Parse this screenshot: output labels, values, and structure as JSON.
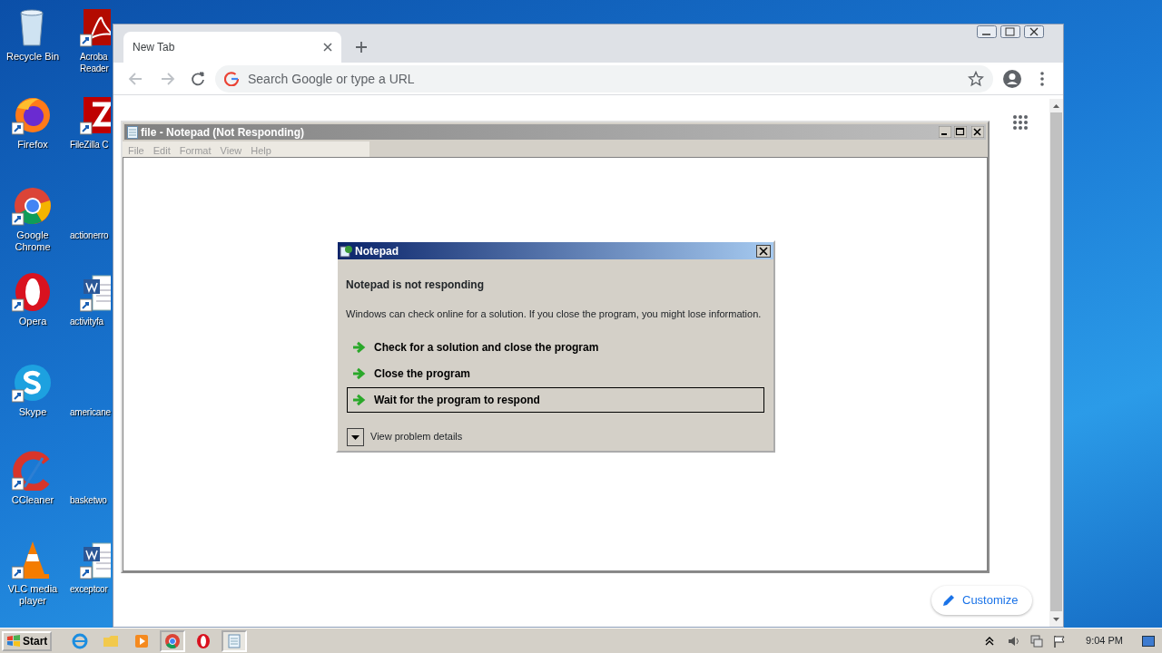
{
  "desktop": {
    "column_1": [
      {
        "label": "Recycle Bin"
      },
      {
        "label": "Firefox"
      },
      {
        "label": "Google Chrome"
      },
      {
        "label": "Opera"
      },
      {
        "label": "Skype"
      },
      {
        "label": "CCleaner"
      },
      {
        "label": "VLC media player"
      }
    ],
    "column_2": [
      {
        "label": "Acroba Reader"
      },
      {
        "label": "FileZilla C"
      },
      {
        "label": "actionerro"
      },
      {
        "label": "activityfa"
      },
      {
        "label": "americane"
      },
      {
        "label": "basketwo"
      },
      {
        "label": "exceptcor"
      }
    ]
  },
  "browser": {
    "tabs": [
      {
        "label": "New Tab",
        "selected": true
      }
    ],
    "omnibox": {
      "placeholder": "Search Google or type a URL"
    },
    "customize_button": "Customize"
  },
  "notepad": {
    "title": "file - Notepad (Not Responding)",
    "menu": [
      "File",
      "Edit",
      "Format",
      "View",
      "Help"
    ]
  },
  "dialog": {
    "title": "Notepad",
    "heading": "Notepad is not responding",
    "message": "Windows can check online for a solution. If you close the program, you might lose information.",
    "options": [
      {
        "label": "Check for a solution and close the program",
        "selected": false
      },
      {
        "label": "Close the program",
        "selected": false
      },
      {
        "label": "Wait for the program to respond",
        "selected": true
      }
    ],
    "details_toggle": "View problem details"
  },
  "taskbar": {
    "start": "Start",
    "clock": "9:04 PM"
  }
}
